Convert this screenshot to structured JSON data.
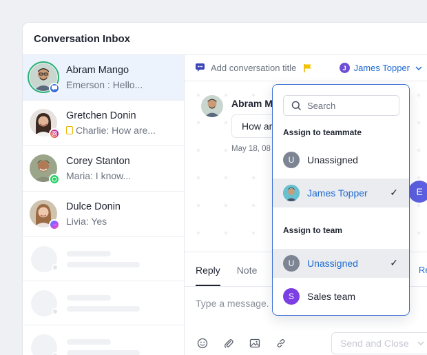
{
  "window": {
    "title": "Conversation Inbox"
  },
  "conversations": [
    {
      "name": "Abram Mango",
      "preview": "Emerson : Hello...",
      "channel": "chat-icon",
      "active": true
    },
    {
      "name": "Gretchen Donin",
      "preview": "Charlie: How are...",
      "channel": "instagram-icon",
      "active": false
    },
    {
      "name": "Corey Stanton",
      "preview": "Maria: I know...",
      "channel": "whatsapp-icon",
      "active": false
    },
    {
      "name": "Dulce Donin",
      "preview": "Livia: Yes",
      "channel": "messenger-icon",
      "active": false
    }
  ],
  "chat": {
    "add_title": "Add conversation title",
    "assignee": "James Topper",
    "assignee_initial": "J",
    "message_author": "Abram M",
    "message_text": "How ar",
    "message_time": "May 18, 08"
  },
  "composer": {
    "tabs": [
      "Reply",
      "Note"
    ],
    "placeholder": "Type a message.",
    "resolve_partial": "Res",
    "send_label": "Send and Close"
  },
  "dropdown": {
    "search_placeholder": "Search",
    "teammate_heading": "Assign to teammate",
    "teammates": [
      {
        "label": "Unassigned",
        "initial": "U",
        "selected": false
      },
      {
        "label": "James Topper",
        "initial": "",
        "selected": true
      }
    ],
    "team_heading": "Assign to team",
    "teams": [
      {
        "label": "Unassigned",
        "initial": "U",
        "selected": true
      },
      {
        "label": "Sales team",
        "initial": "S",
        "selected": false
      }
    ]
  },
  "side_badge": "E",
  "colors": {
    "accent": "#1f6bd1",
    "active_row": "#edf3fc",
    "online_ring": "#2ab274",
    "team_purple": "#7b3fe4",
    "gray_avatar": "#7d8593"
  }
}
